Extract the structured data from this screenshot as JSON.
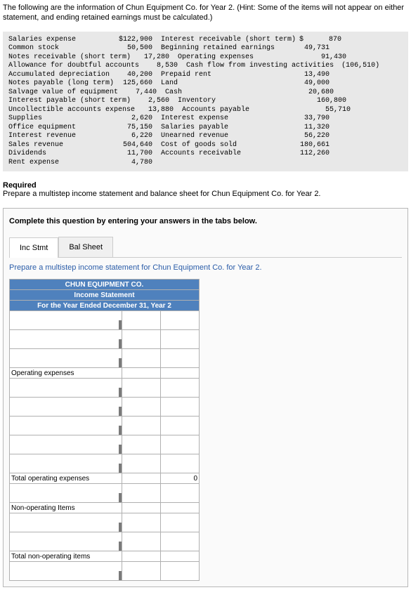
{
  "intro_text": "The following are the information of Chun Equipment Co. for Year 2. (Hint: Some of the items will not appear on either statement, and ending retained earnings must be calculated.)",
  "trial": {
    "left": [
      {
        "label": "Salaries expense",
        "value": "$122,900"
      },
      {
        "label": "Common stock",
        "value": "50,500"
      },
      {
        "label": "Notes receivable (short term)",
        "value": "17,280"
      },
      {
        "label": "Allowance for doubtful accounts",
        "value": "8,530"
      },
      {
        "label": "Accumulated depreciation",
        "value": "40,200"
      },
      {
        "label": "Notes payable (long term)",
        "value": "125,660"
      },
      {
        "label": "Salvage value of equipment",
        "value": "7,440"
      },
      {
        "label": "Interest payable (short term)",
        "value": "2,560"
      },
      {
        "label": "Uncollectible accounts expense",
        "value": "13,880"
      },
      {
        "label": "Supplies",
        "value": "2,620"
      },
      {
        "label": "Office equipment",
        "value": "75,150"
      },
      {
        "label": "Interest revenue",
        "value": "6,220"
      },
      {
        "label": "Sales revenue",
        "value": "504,640"
      },
      {
        "label": "Dividends",
        "value": "11,700"
      },
      {
        "label": "Rent expense",
        "value": "4,780"
      }
    ],
    "right": [
      {
        "label": "Interest receivable (short term)",
        "value": "$      870"
      },
      {
        "label": "Beginning retained earnings",
        "value": "49,731"
      },
      {
        "label": "Operating expenses",
        "value": "91,430"
      },
      {
        "label": "Cash flow from investing activities",
        "value": "(106,510)"
      },
      {
        "label": "Prepaid rent",
        "value": "13,490"
      },
      {
        "label": "Land",
        "value": "49,000"
      },
      {
        "label": "Cash",
        "value": "20,680"
      },
      {
        "label": "Inventory",
        "value": "160,800"
      },
      {
        "label": "Accounts payable",
        "value": "55,710"
      },
      {
        "label": "Interest expense",
        "value": "33,790"
      },
      {
        "label": "Salaries payable",
        "value": "11,320"
      },
      {
        "label": "Unearned revenue",
        "value": "56,220"
      },
      {
        "label": "Cost of goods sold",
        "value": "180,661"
      },
      {
        "label": "Accounts receivable",
        "value": "112,260"
      }
    ]
  },
  "required_label": "Required",
  "required_text": "Prepare a multistep income statement and balance sheet for Chun Equipment Co. for Year 2.",
  "complete_banner": "Complete this question by entering your answers in the tabs below.",
  "tabs": {
    "inc": "Inc Stmt",
    "bal": "Bal Sheet"
  },
  "sub_instruction": "Prepare a multistep income statement for Chun Equipment Co. for Year 2.",
  "worksheet": {
    "title1": "CHUN EQUIPMENT CO.",
    "title2": "Income Statement",
    "title3": "For the Year Ended December 31, Year 2",
    "row_opex": "Operating expenses",
    "row_total_opex": "Total operating expenses",
    "row_total_opex_val": "0",
    "row_nonop": "Non-operating Items",
    "row_total_nonop": "Total non-operating items"
  }
}
